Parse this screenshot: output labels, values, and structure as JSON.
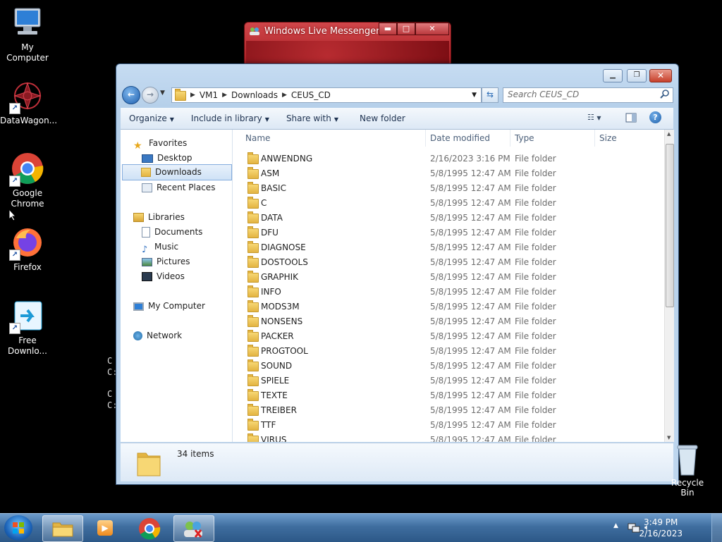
{
  "desktop": {
    "icons": [
      {
        "label": "My Computer"
      },
      {
        "label": "DataWagon..."
      },
      {
        "label": "Google Chrome"
      },
      {
        "label": "Firefox"
      },
      {
        "label": "Free Downlo..."
      }
    ],
    "recycle_bin": "Recycle Bin",
    "stray_text": [
      "C",
      "C:",
      "C",
      "C:"
    ]
  },
  "messenger": {
    "title": "Windows Live Messenger"
  },
  "explorer": {
    "breadcrumb": [
      "VM1",
      "Downloads",
      "CEUS_CD"
    ],
    "search_placeholder": "Search CEUS_CD",
    "toolbar": {
      "organize": "Organize",
      "include_in_library": "Include in library",
      "share_with": "Share with",
      "new_folder": "New folder"
    },
    "nav": {
      "favorites": "Favorites",
      "desktop": "Desktop",
      "downloads": "Downloads",
      "recent_places": "Recent Places",
      "libraries": "Libraries",
      "documents": "Documents",
      "music": "Music",
      "pictures": "Pictures",
      "videos": "Videos",
      "my_computer": "My Computer",
      "network": "Network"
    },
    "columns": {
      "name": "Name",
      "date": "Date modified",
      "type": "Type",
      "size": "Size"
    },
    "files": [
      {
        "name": "ANWENDNG",
        "date": "2/16/2023 3:16 PM",
        "type": "File folder"
      },
      {
        "name": "ASM",
        "date": "5/8/1995 12:47 AM",
        "type": "File folder"
      },
      {
        "name": "BASIC",
        "date": "5/8/1995 12:47 AM",
        "type": "File folder"
      },
      {
        "name": "C",
        "date": "5/8/1995 12:47 AM",
        "type": "File folder"
      },
      {
        "name": "DATA",
        "date": "5/8/1995 12:47 AM",
        "type": "File folder"
      },
      {
        "name": "DFU",
        "date": "5/8/1995 12:47 AM",
        "type": "File folder"
      },
      {
        "name": "DIAGNOSE",
        "date": "5/8/1995 12:47 AM",
        "type": "File folder"
      },
      {
        "name": "DOSTOOLS",
        "date": "5/8/1995 12:47 AM",
        "type": "File folder"
      },
      {
        "name": "GRAPHIK",
        "date": "5/8/1995 12:47 AM",
        "type": "File folder"
      },
      {
        "name": "INFO",
        "date": "5/8/1995 12:47 AM",
        "type": "File folder"
      },
      {
        "name": "MODS3M",
        "date": "5/8/1995 12:47 AM",
        "type": "File folder"
      },
      {
        "name": "NONSENS",
        "date": "5/8/1995 12:47 AM",
        "type": "File folder"
      },
      {
        "name": "PACKER",
        "date": "5/8/1995 12:47 AM",
        "type": "File folder"
      },
      {
        "name": "PROGTOOL",
        "date": "5/8/1995 12:47 AM",
        "type": "File folder"
      },
      {
        "name": "SOUND",
        "date": "5/8/1995 12:47 AM",
        "type": "File folder"
      },
      {
        "name": "SPIELE",
        "date": "5/8/1995 12:47 AM",
        "type": "File folder"
      },
      {
        "name": "TEXTE",
        "date": "5/8/1995 12:47 AM",
        "type": "File folder"
      },
      {
        "name": "TREIBER",
        "date": "5/8/1995 12:47 AM",
        "type": "File folder"
      },
      {
        "name": "TTF",
        "date": "5/8/1995 12:47 AM",
        "type": "File folder"
      },
      {
        "name": "VIRUS",
        "date": "5/8/1995 12:47 AM",
        "type": "File folder"
      }
    ],
    "status": "34 items"
  },
  "taskbar": {
    "time": "3:49 PM",
    "date": "2/16/2023"
  }
}
